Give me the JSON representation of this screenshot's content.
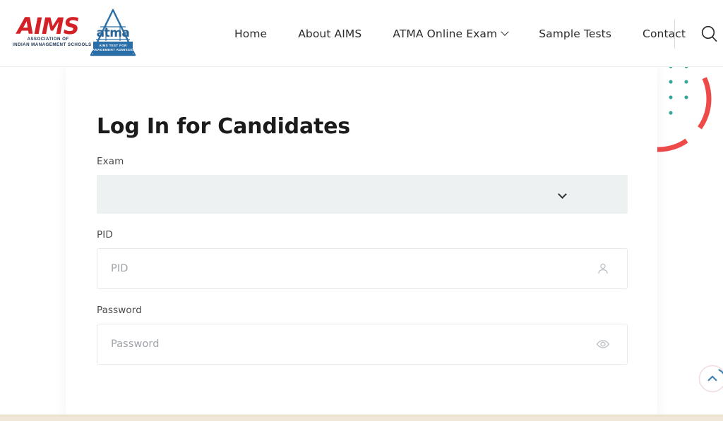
{
  "header": {
    "logos": {
      "aims": {
        "wordmark": "AIMS",
        "sub_line1": "ASSOCIATION OF",
        "sub_line2": "INDIAN MANAGEMENT SCHOOLS"
      },
      "atma": {
        "wordmark": "atma",
        "banner_line1": "AIMS TEST FOR",
        "banner_line2": "MANAGEMENT ADMISSION"
      }
    },
    "nav": [
      {
        "label": "Home",
        "has_dropdown": false
      },
      {
        "label": "About AIMS",
        "has_dropdown": false
      },
      {
        "label": "ATMA Online Exam",
        "has_dropdown": true
      },
      {
        "label": "Sample Tests",
        "has_dropdown": false
      },
      {
        "label": "Contact",
        "has_dropdown": false
      }
    ],
    "search_icon": "search-icon"
  },
  "main": {
    "title": "Log In for Candidates",
    "fields": {
      "exam": {
        "label": "Exam",
        "value": "",
        "placeholder": "",
        "control": "select",
        "chevron_icon": "chevron-down-icon"
      },
      "pid": {
        "label": "PID",
        "value": "",
        "placeholder": "PID",
        "control": "text",
        "icon": "user-icon"
      },
      "password": {
        "label": "Password",
        "value": "",
        "placeholder": "Password",
        "control": "password",
        "icon": "eye-icon"
      }
    }
  },
  "widgets": {
    "scroll_top": {
      "icon": "chevron-up-icon",
      "label": "Back to top"
    }
  },
  "colors": {
    "brand_red": "#d42027",
    "brand_navy": "#1d3557",
    "atma_blue": "#2a6ea8",
    "decor_coral": "#ef4a4a",
    "decor_teal": "#3aa79a",
    "select_bg": "#eef1f2",
    "page_bg": "#ffffff",
    "bottom_strip": "#f1e7d9"
  }
}
